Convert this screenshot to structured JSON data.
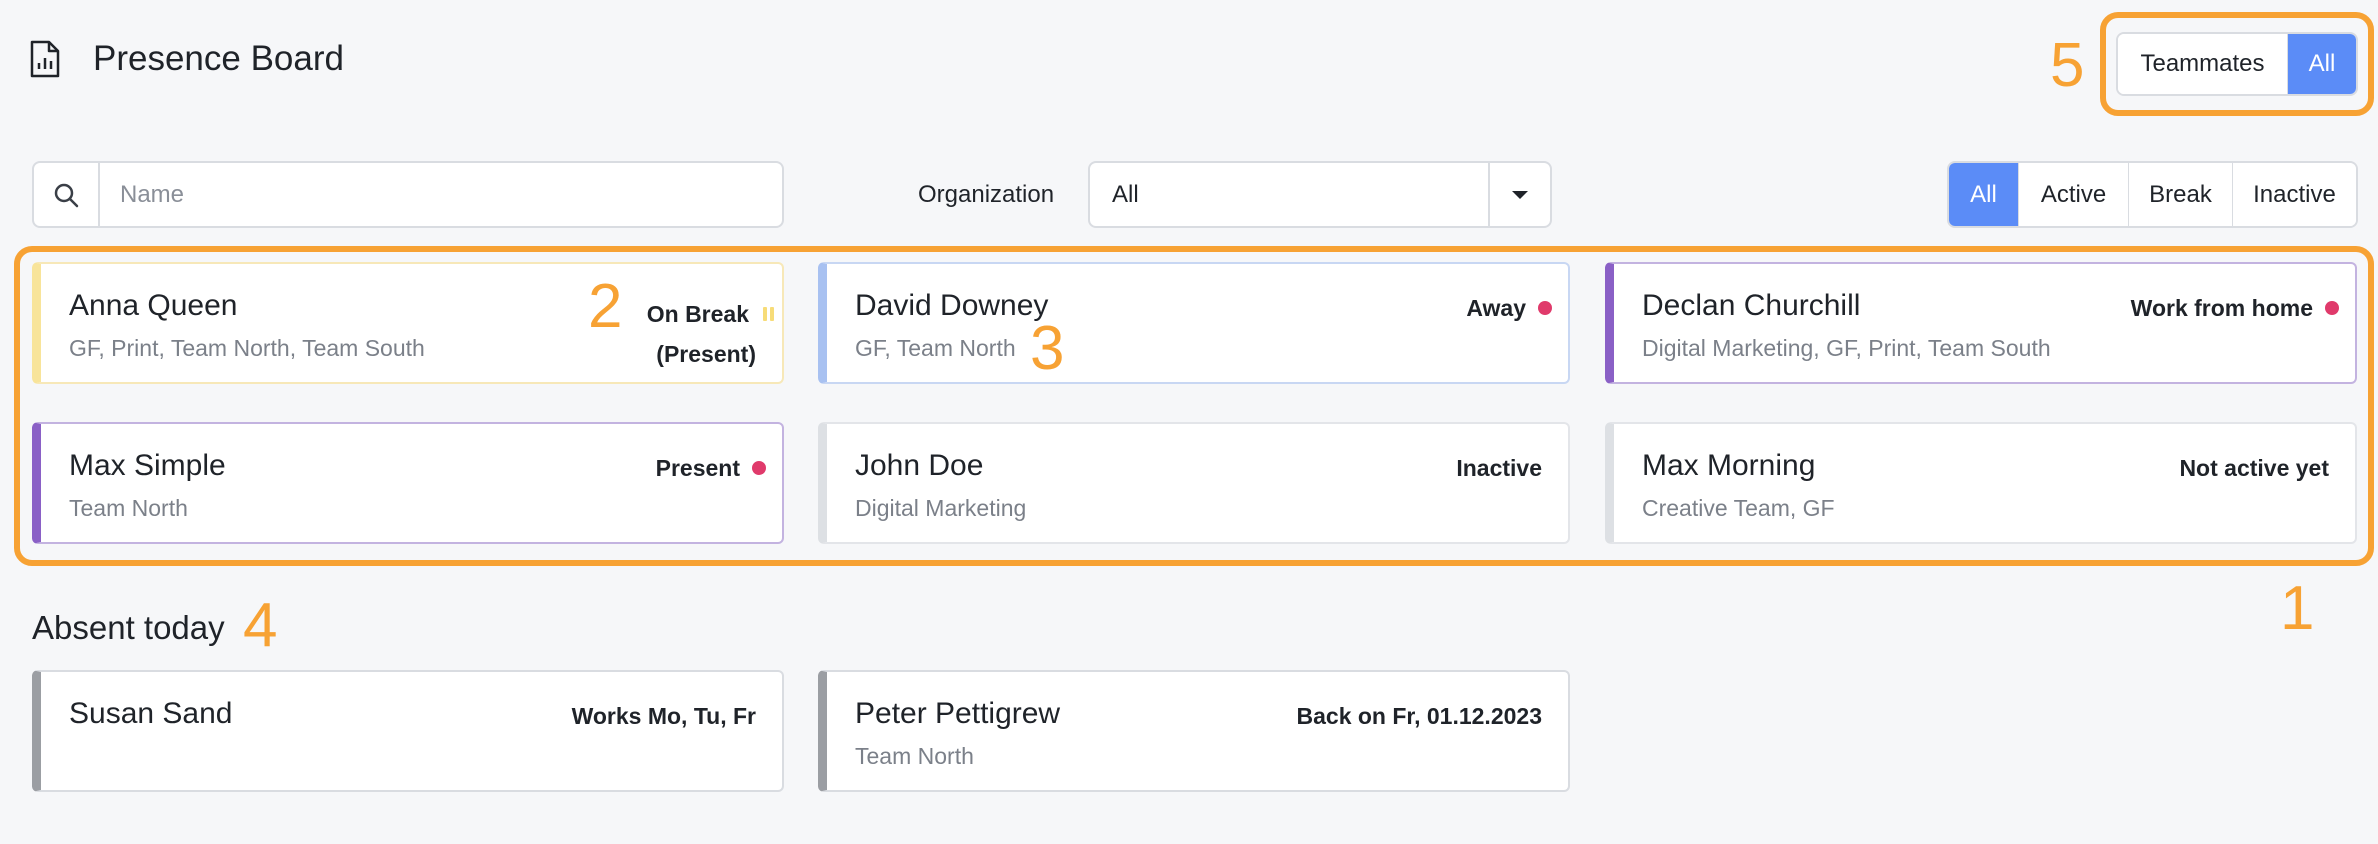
{
  "header": {
    "title": "Presence Board",
    "icon": "report-document-icon"
  },
  "view_toggle": {
    "options": [
      "Teammates",
      "All"
    ],
    "selected": "All",
    "active_color": "#5b8cf7"
  },
  "search": {
    "placeholder": "Name",
    "value": ""
  },
  "organization": {
    "label": "Organization",
    "value": "All"
  },
  "status_filter": {
    "options": [
      "All",
      "Active",
      "Break",
      "Inactive"
    ],
    "selected": "All"
  },
  "present_cards": [
    {
      "name": "Anna Queen",
      "teams": "GF, Print, Team North, Team South",
      "status_line1": "On Break",
      "status_line2": "(Present)",
      "indicator": "pause-icon",
      "accent": "#f8e49a"
    },
    {
      "name": "David Downey",
      "teams": "GF, Team North",
      "status": "Away",
      "indicator": "status-dot",
      "accent": "#a8c1f1"
    },
    {
      "name": "Declan Churchill",
      "teams": "Digital Marketing, GF, Print, Team South",
      "status": "Work from home",
      "indicator": "status-dot",
      "accent": "#8a60c6"
    },
    {
      "name": "Max Simple",
      "teams": "Team North",
      "status": "Present",
      "indicator": "status-dot",
      "accent": "#8a60c6"
    },
    {
      "name": "John Doe",
      "teams": "Digital Marketing",
      "status": "Inactive",
      "accent": "#dde0e4"
    },
    {
      "name": "Max Morning",
      "teams": "Creative Team, GF",
      "status": "Not active yet",
      "accent": "#dde0e4"
    }
  ],
  "absent": {
    "title": "Absent today",
    "cards": [
      {
        "name": "Susan Sand",
        "teams": "",
        "status": "Works Mo, Tu, Fr",
        "accent": "#9b9ea3"
      },
      {
        "name": "Peter Pettigrew",
        "teams": "Team North",
        "status": "Back on Fr, 01.12.2023",
        "accent": "#9b9ea3"
      }
    ]
  },
  "annotations": {
    "color": "#f7a234",
    "labels": [
      "1",
      "2",
      "3",
      "4",
      "5"
    ]
  }
}
